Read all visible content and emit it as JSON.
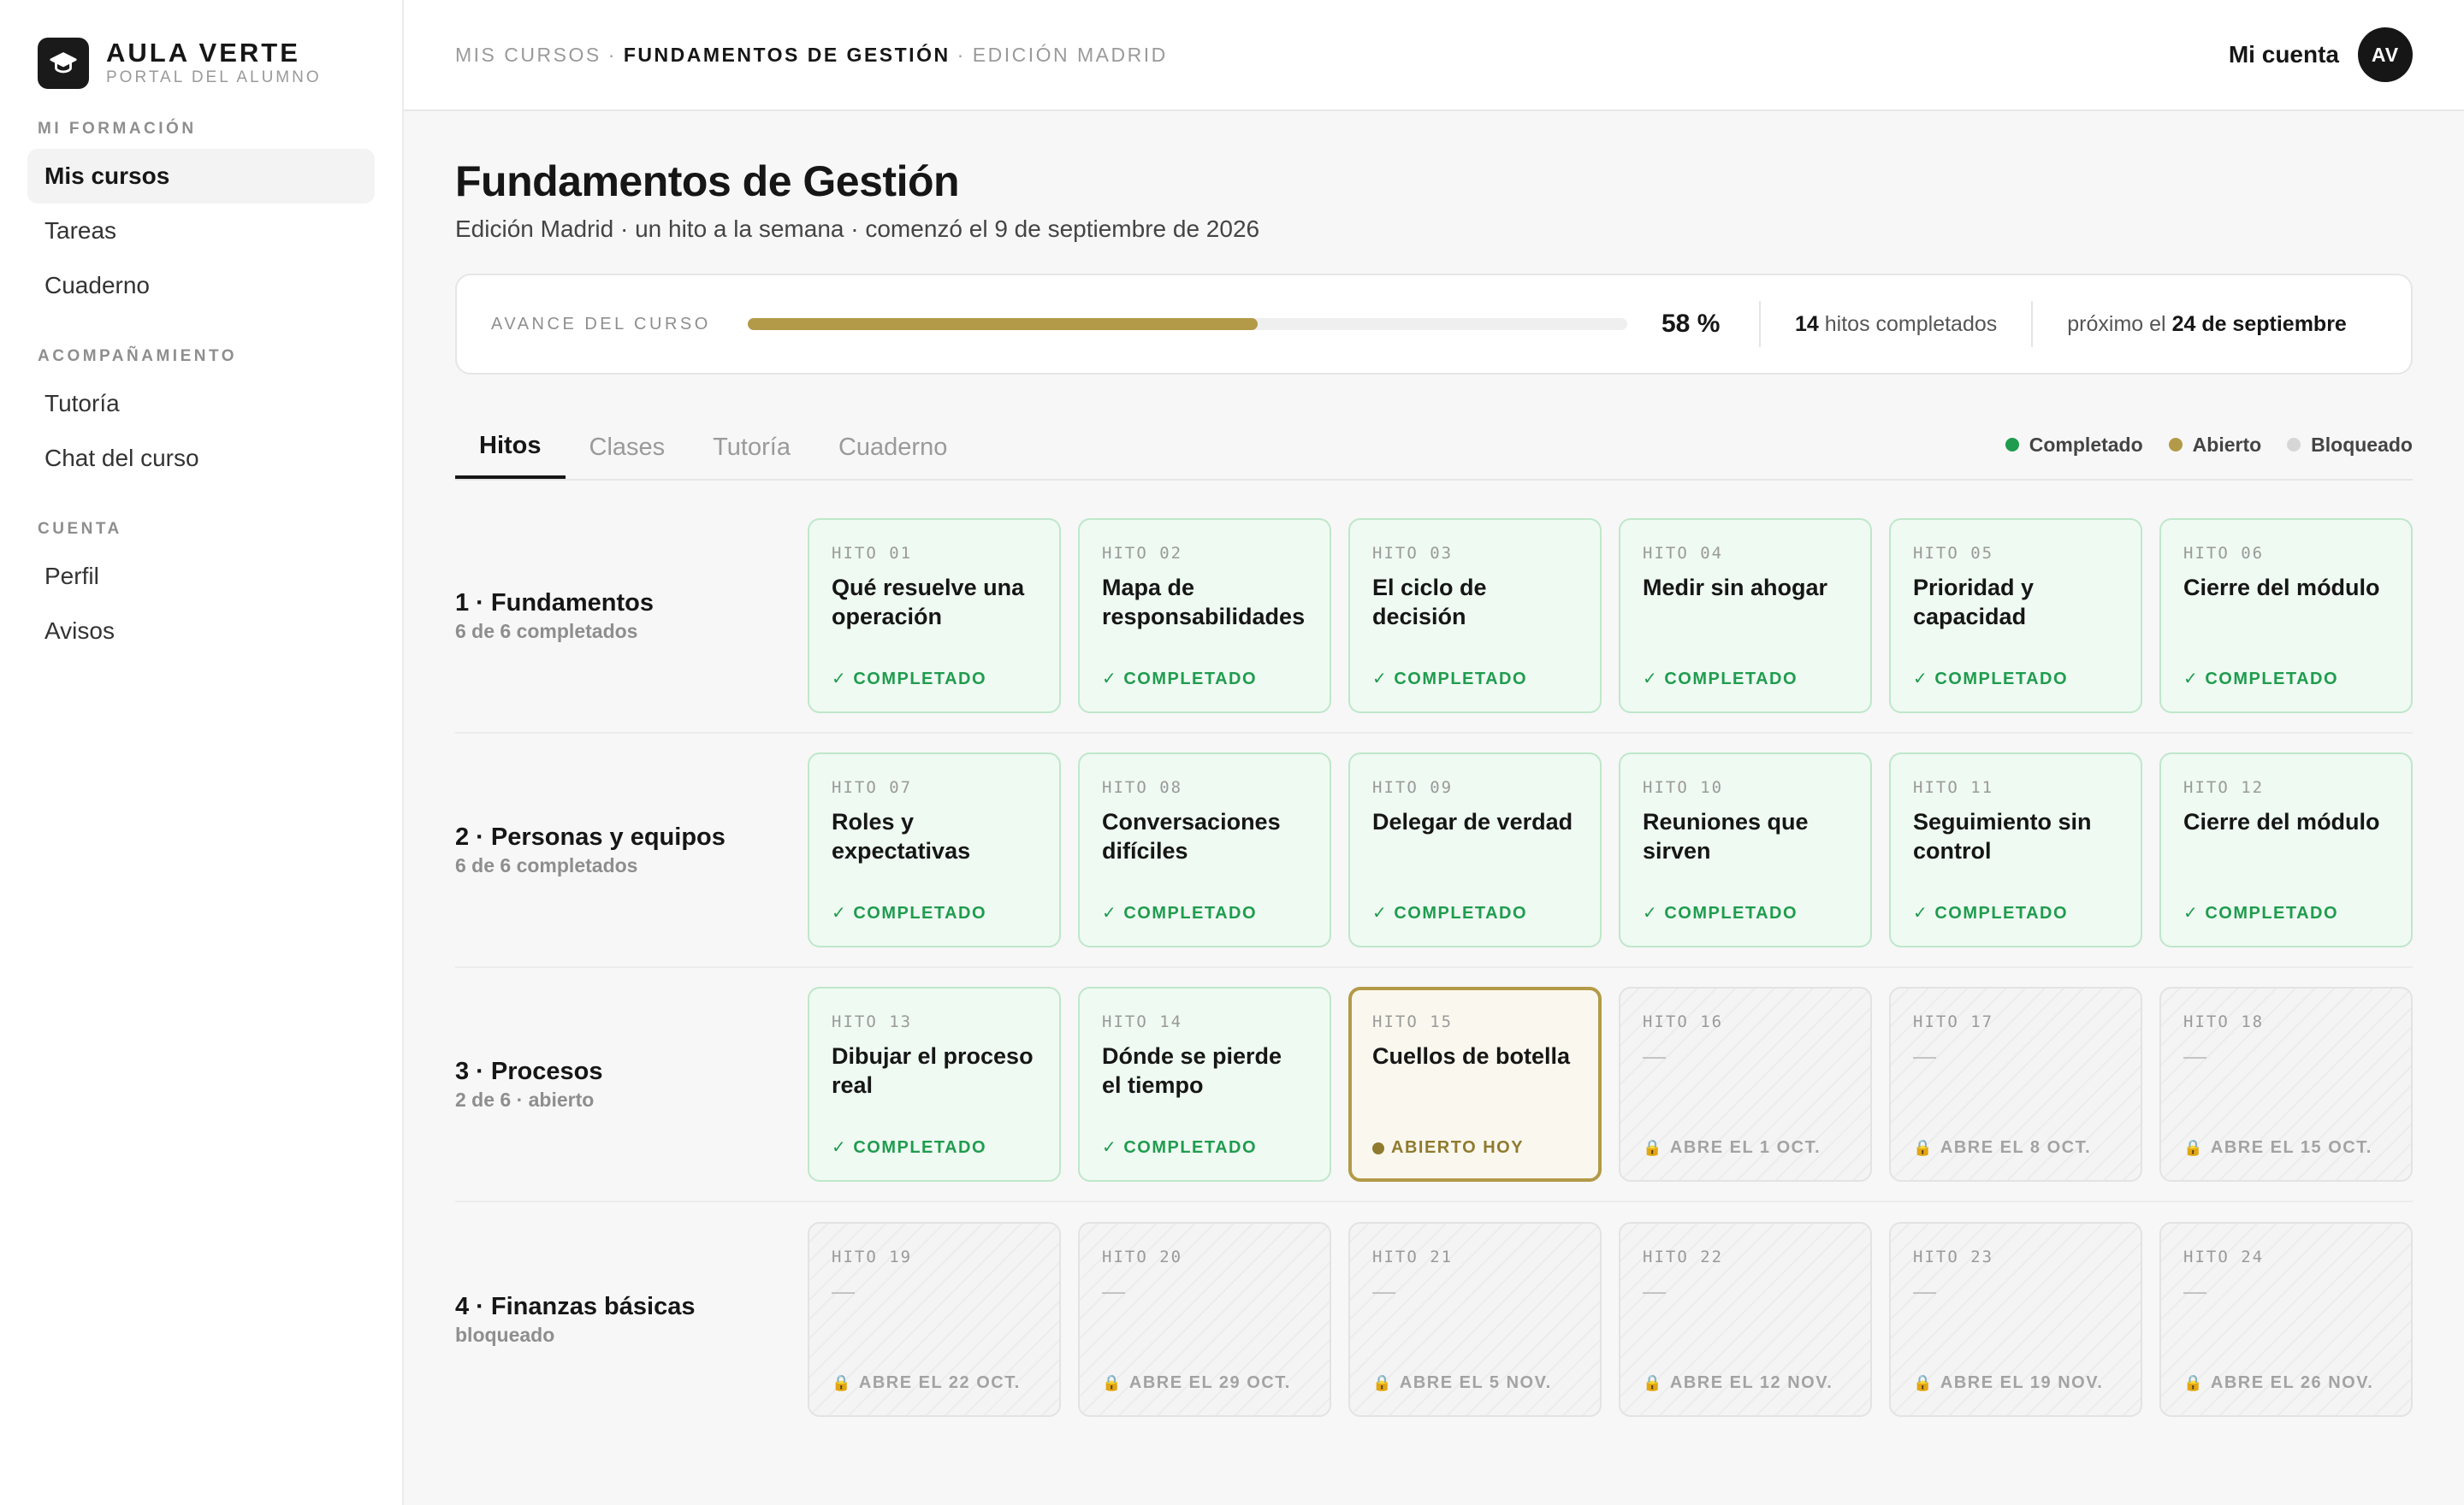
{
  "brand": {
    "title": "AULA VERTE",
    "subtitle": "PORTAL DEL ALUMNO"
  },
  "sidebar": {
    "sections": [
      {
        "title": "MI FORMACIÓN",
        "items": [
          {
            "label": "Mis cursos",
            "active": true
          },
          {
            "label": "Tareas",
            "active": false
          },
          {
            "label": "Cuaderno",
            "active": false
          }
        ]
      },
      {
        "title": "ACOMPAÑAMIENTO",
        "items": [
          {
            "label": "Tutoría",
            "active": false
          },
          {
            "label": "Chat del curso",
            "active": false
          }
        ]
      },
      {
        "title": "CUENTA",
        "items": [
          {
            "label": "Perfil",
            "active": false
          },
          {
            "label": "Avisos",
            "active": false
          }
        ]
      }
    ]
  },
  "breadcrumb": {
    "items": [
      "MIS CURSOS",
      "FUNDAMENTOS DE GESTIÓN",
      "EDICIÓN MADRID"
    ],
    "separator": "·",
    "current_index": 1
  },
  "account": {
    "label": "Mi cuenta",
    "initials": "AV"
  },
  "course": {
    "title": "Fundamentos de Gestión",
    "subtitle": "Edición Madrid · un hito a la semana · comenzó el 9 de septiembre de 2026"
  },
  "progress": {
    "label": "AVANCE DEL CURSO",
    "percent": 58,
    "percent_text": "58 %",
    "completed_count": "14",
    "completed_text": "hitos completados",
    "next_prefix": "próximo el",
    "next_date": "24 de septiembre"
  },
  "tabs": [
    {
      "label": "Hitos",
      "active": true
    },
    {
      "label": "Clases",
      "active": false
    },
    {
      "label": "Tutoría",
      "active": false
    },
    {
      "label": "Cuaderno",
      "active": false
    }
  ],
  "legend": [
    {
      "label": "Completado",
      "color": "#1f9c4e"
    },
    {
      "label": "Abierto",
      "color": "#b39a48"
    },
    {
      "label": "Bloqueado",
      "color": "#d6d6d6"
    }
  ],
  "modules": [
    {
      "title": "1 · Fundamentos",
      "status": "6 de 6 completados",
      "milestones": [
        {
          "num": "HITO 01",
          "title": "Qué resuelve una operación",
          "state": "completed",
          "status": "✓ COMPLETADO"
        },
        {
          "num": "HITO 02",
          "title": "Mapa de responsabilidades",
          "state": "completed",
          "status": "✓ COMPLETADO"
        },
        {
          "num": "HITO 03",
          "title": "El ciclo de decisión",
          "state": "completed",
          "status": "✓ COMPLETADO"
        },
        {
          "num": "HITO 04",
          "title": "Medir sin ahogar",
          "state": "completed",
          "status": "✓ COMPLETADO"
        },
        {
          "num": "HITO 05",
          "title": "Prioridad y capacidad",
          "state": "completed",
          "status": "✓ COMPLETADO"
        },
        {
          "num": "HITO 06",
          "title": "Cierre del módulo",
          "state": "completed",
          "status": "✓ COMPLETADO"
        }
      ]
    },
    {
      "title": "2 · Personas y equipos",
      "status": "6 de 6 completados",
      "milestones": [
        {
          "num": "HITO 07",
          "title": "Roles y expectativas",
          "state": "completed",
          "status": "✓ COMPLETADO"
        },
        {
          "num": "HITO 08",
          "title": "Conversaciones difíciles",
          "state": "completed",
          "status": "✓ COMPLETADO"
        },
        {
          "num": "HITO 09",
          "title": "Delegar de verdad",
          "state": "completed",
          "status": "✓ COMPLETADO"
        },
        {
          "num": "HITO 10",
          "title": "Reuniones que sirven",
          "state": "completed",
          "status": "✓ COMPLETADO"
        },
        {
          "num": "HITO 11",
          "title": "Seguimiento sin control",
          "state": "completed",
          "status": "✓ COMPLETADO"
        },
        {
          "num": "HITO 12",
          "title": "Cierre del módulo",
          "state": "completed",
          "status": "✓ COMPLETADO"
        }
      ]
    },
    {
      "title": "3 · Procesos",
      "status": "2 de 6 · abierto",
      "milestones": [
        {
          "num": "HITO 13",
          "title": "Dibujar el proceso real",
          "state": "completed",
          "status": "✓ COMPLETADO"
        },
        {
          "num": "HITO 14",
          "title": "Dónde se pierde el tiempo",
          "state": "completed",
          "status": "✓ COMPLETADO"
        },
        {
          "num": "HITO 15",
          "title": "Cuellos de botella",
          "state": "open",
          "status": "ABIERTO HOY"
        },
        {
          "num": "HITO 16",
          "title": "—",
          "state": "locked",
          "status": "ABRE EL 1 OCT."
        },
        {
          "num": "HITO 17",
          "title": "—",
          "state": "locked",
          "status": "ABRE EL 8 OCT."
        },
        {
          "num": "HITO 18",
          "title": "—",
          "state": "locked",
          "status": "ABRE EL 15 OCT."
        }
      ]
    },
    {
      "title": "4 · Finanzas básicas",
      "status": "bloqueado",
      "milestones": [
        {
          "num": "HITO 19",
          "title": "—",
          "state": "locked",
          "status": "ABRE EL 22 OCT."
        },
        {
          "num": "HITO 20",
          "title": "—",
          "state": "locked",
          "status": "ABRE EL 29 OCT."
        },
        {
          "num": "HITO 21",
          "title": "—",
          "state": "locked",
          "status": "ABRE EL 5 NOV."
        },
        {
          "num": "HITO 22",
          "title": "—",
          "state": "locked",
          "status": "ABRE EL 12 NOV."
        },
        {
          "num": "HITO 23",
          "title": "—",
          "state": "locked",
          "status": "ABRE EL 19 NOV."
        },
        {
          "num": "HITO 24",
          "title": "—",
          "state": "locked",
          "status": "ABRE EL 26 NOV."
        }
      ]
    }
  ]
}
